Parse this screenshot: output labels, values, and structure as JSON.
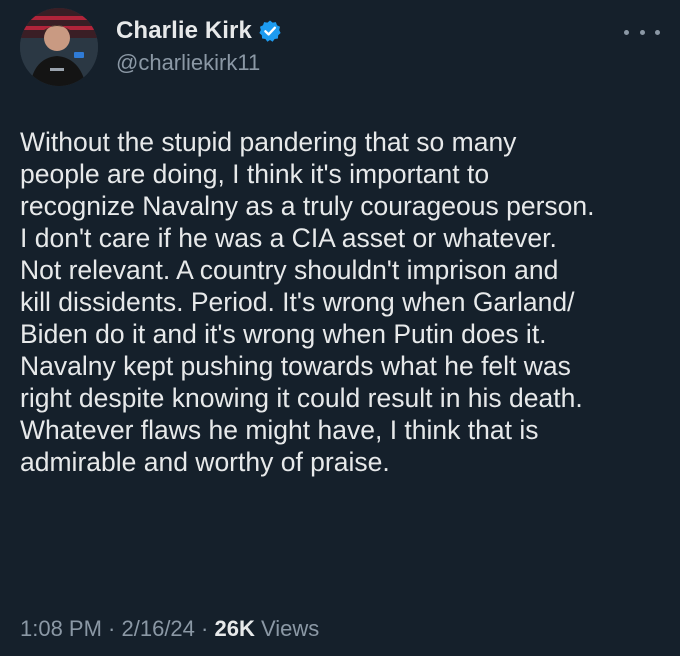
{
  "author": {
    "display_name": "Charlie Kirk",
    "handle": "@charliekirk11",
    "verified_badge_color": "#1d9bf0"
  },
  "tweet": {
    "lines": [
      "Without the stupid pandering that so many",
      "people are doing, I think it's important to",
      "recognize Navalny as a truly courageous person.",
      "I don't care if he was a CIA asset or whatever.",
      "Not relevant. A country shouldn't imprison and",
      "kill dissidents. Period. It's wrong when Garland/",
      "Biden do it and it's wrong when Putin does it.",
      "Navalny kept pushing towards what he felt was",
      "right despite knowing it could result in his death.",
      "Whatever flaws he might have, I think that is",
      "admirable and worthy of praise."
    ]
  },
  "meta": {
    "time": "1:08 PM",
    "separator": " · ",
    "date": "2/16/24",
    "views_count": "26K",
    "views_label": " Views"
  },
  "icons": {
    "more": "more-horizontal-icon",
    "verified": "verified-badge-icon"
  },
  "colors": {
    "background": "#15202b",
    "text": "#e7e9ea",
    "secondary_text": "#8b98a5"
  }
}
